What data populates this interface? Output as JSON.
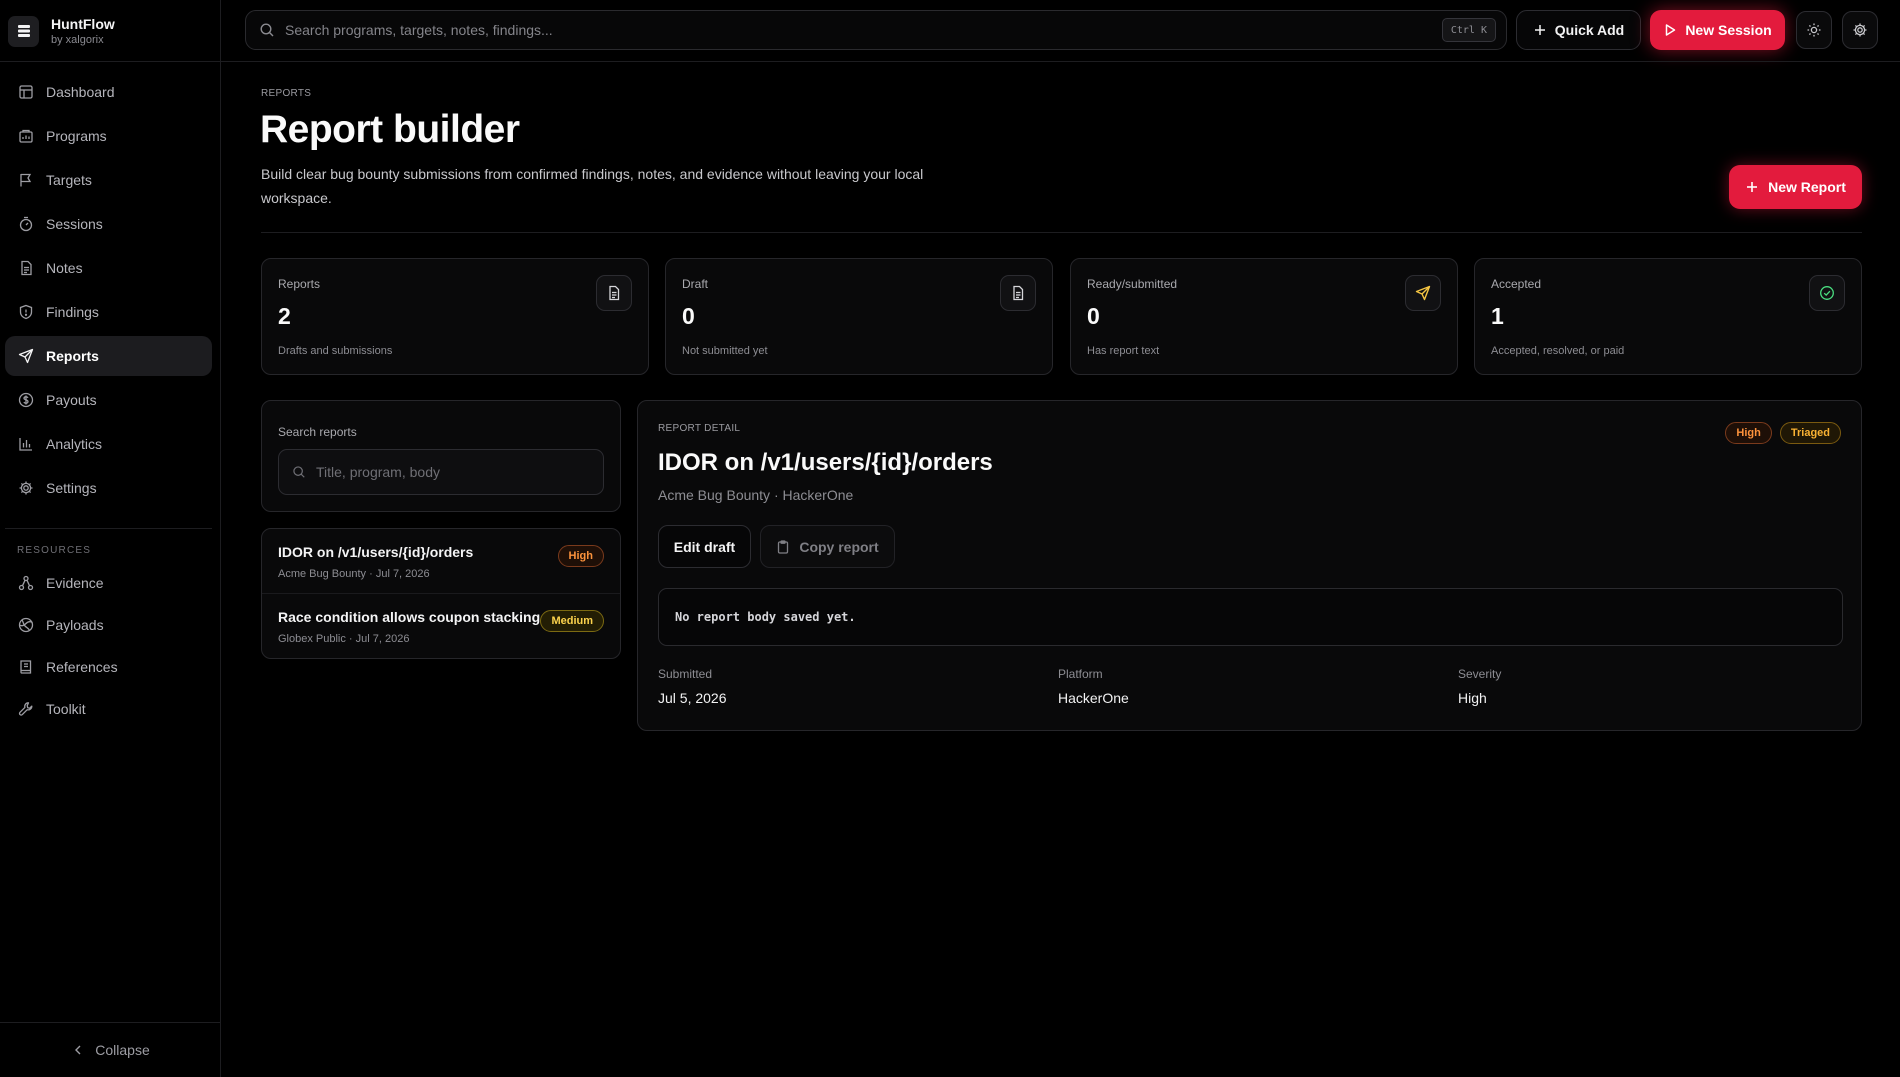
{
  "brand": {
    "name": "HuntFlow",
    "sub": "by xalgorix"
  },
  "sidebar": {
    "items": [
      {
        "label": "Dashboard",
        "icon": "dashboard-icon"
      },
      {
        "label": "Programs",
        "icon": "programs-icon"
      },
      {
        "label": "Targets",
        "icon": "flag-icon"
      },
      {
        "label": "Sessions",
        "icon": "stopwatch-icon"
      },
      {
        "label": "Notes",
        "icon": "note-icon"
      },
      {
        "label": "Findings",
        "icon": "shield-icon"
      },
      {
        "label": "Reports",
        "icon": "send-icon",
        "active": true
      },
      {
        "label": "Payouts",
        "icon": "dollar-icon"
      },
      {
        "label": "Analytics",
        "icon": "bar-chart-icon"
      },
      {
        "label": "Settings",
        "icon": "gear-icon"
      }
    ],
    "resources_label": "RESOURCES",
    "resources": [
      {
        "label": "Evidence",
        "icon": "evidence-icon"
      },
      {
        "label": "Payloads",
        "icon": "payload-icon"
      },
      {
        "label": "References",
        "icon": "book-icon"
      },
      {
        "label": "Toolkit",
        "icon": "wrench-icon"
      }
    ],
    "collapse_label": "Collapse"
  },
  "topbar": {
    "search_placeholder": "Search programs, targets, notes, findings...",
    "shortcut": "Ctrl K",
    "quick_add_label": "Quick Add",
    "new_session_label": "New Session"
  },
  "page": {
    "eyebrow": "REPORTS",
    "title": "Report builder",
    "description": "Build clear bug bounty submissions from confirmed findings, notes, and evidence without leaving your local workspace.",
    "new_report_label": "New Report"
  },
  "stats": [
    {
      "label": "Reports",
      "value": "2",
      "sub": "Drafts and submissions",
      "icon": "document-icon"
    },
    {
      "label": "Draft",
      "value": "0",
      "sub": "Not submitted yet",
      "icon": "document-icon"
    },
    {
      "label": "Ready/submitted",
      "value": "0",
      "sub": "Has report text",
      "icon": "send-icon"
    },
    {
      "label": "Accepted",
      "value": "1",
      "sub": "Accepted, resolved, or paid",
      "icon": "check-circle-icon"
    }
  ],
  "search_reports": {
    "label": "Search reports",
    "placeholder": "Title, program, body"
  },
  "reports": [
    {
      "title": "IDOR on /v1/users/{id}/orders",
      "meta": "Acme Bug Bounty · Jul 7, 2026",
      "severity": "High"
    },
    {
      "title": "Race condition allows coupon stacking",
      "meta": "Globex Public · Jul 7, 2026",
      "severity": "Medium"
    }
  ],
  "detail": {
    "eyebrow": "REPORT DETAIL",
    "severity_badge": "High",
    "status_badge": "Triaged",
    "title": "IDOR on /v1/users/{id}/orders",
    "subtitle": "Acme Bug Bounty · HackerOne",
    "edit_label": "Edit draft",
    "copy_label": "Copy report",
    "body": "No report body saved yet.",
    "fields": [
      {
        "label": "Submitted",
        "value": "Jul 5, 2026"
      },
      {
        "label": "Platform",
        "value": "HackerOne"
      },
      {
        "label": "Severity",
        "value": "High"
      }
    ]
  },
  "colors": {
    "accent": "#e31b3d",
    "background": "#000000",
    "high": "#fb923c",
    "medium": "#fcd34d",
    "triaged": "#f9b233",
    "send_icon": "#f5c542",
    "check_icon": "#4ade80"
  }
}
